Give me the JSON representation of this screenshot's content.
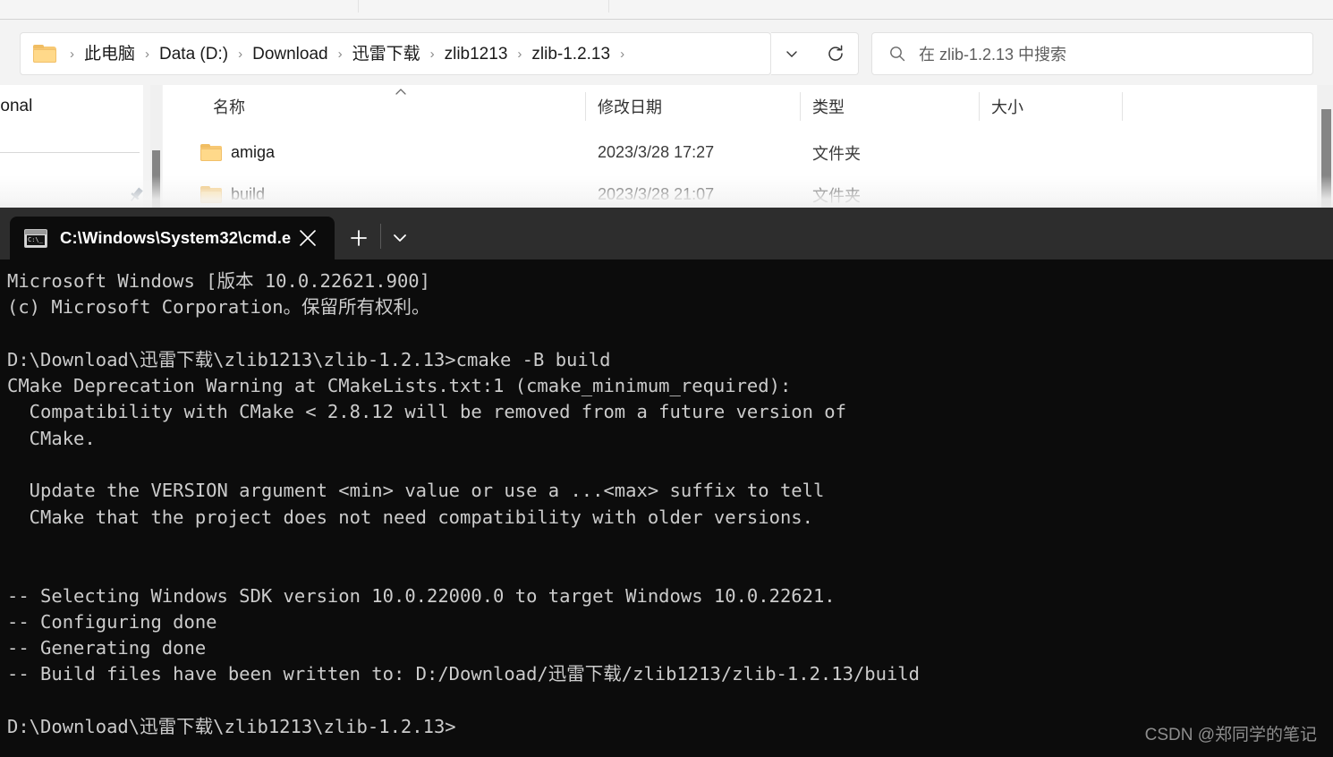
{
  "explorer": {
    "address_bar": {
      "folder_icon": "folder-icon",
      "crumbs": [
        "此电脑",
        "Data (D:)",
        "Download",
        "迅雷下载",
        "zlib1213",
        "zlib-1.2.13"
      ],
      "separator": "›",
      "trailing_separator": "›",
      "dropdown_icon": "chevron-down-icon",
      "refresh_icon": "refresh-icon"
    },
    "search": {
      "icon": "search-icon",
      "placeholder": "在 zlib-1.2.13 中搜索"
    },
    "sidebar": {
      "visible_item": "ersonal",
      "pin_icon": "pin-icon"
    },
    "file_list": {
      "sort_indicator": "chevron-up-icon",
      "columns": [
        "名称",
        "修改日期",
        "类型",
        "大小"
      ],
      "rows": [
        {
          "name": "amiga",
          "modified": "2023/3/28 17:27",
          "type": "文件夹",
          "size": ""
        },
        {
          "name": "build",
          "modified": "2023/3/28 21:07",
          "type": "文件夹",
          "size": ""
        }
      ]
    }
  },
  "terminal": {
    "tab": {
      "icon": "cmd-window-icon",
      "icon_glyph": "C:\\_",
      "title": "C:\\Windows\\System32\\cmd.e",
      "close_icon": "close-icon",
      "new_tab_icon": "plus-icon",
      "dropdown_icon": "chevron-down-icon"
    },
    "content": "Microsoft Windows [版本 10.0.22621.900]\n(c) Microsoft Corporation。保留所有权利。\n\nD:\\Download\\迅雷下载\\zlib1213\\zlib-1.2.13>cmake -B build\nCMake Deprecation Warning at CMakeLists.txt:1 (cmake_minimum_required):\n  Compatibility with CMake < 2.8.12 will be removed from a future version of\n  CMake.\n\n  Update the VERSION argument <min> value or use a ...<max> suffix to tell\n  CMake that the project does not need compatibility with older versions.\n\n\n-- Selecting Windows SDK version 10.0.22000.0 to target Windows 10.0.22621.\n-- Configuring done\n-- Generating done\n-- Build files have been written to: D:/Download/迅雷下载/zlib1213/zlib-1.2.13/build\n\nD:\\Download\\迅雷下载\\zlib1213\\zlib-1.2.13>",
    "background_color": "#0c0c0c",
    "tabbar_color": "#2d2d2d",
    "text_color": "#cccccc"
  },
  "watermark": "CSDN @郑同学的笔记"
}
